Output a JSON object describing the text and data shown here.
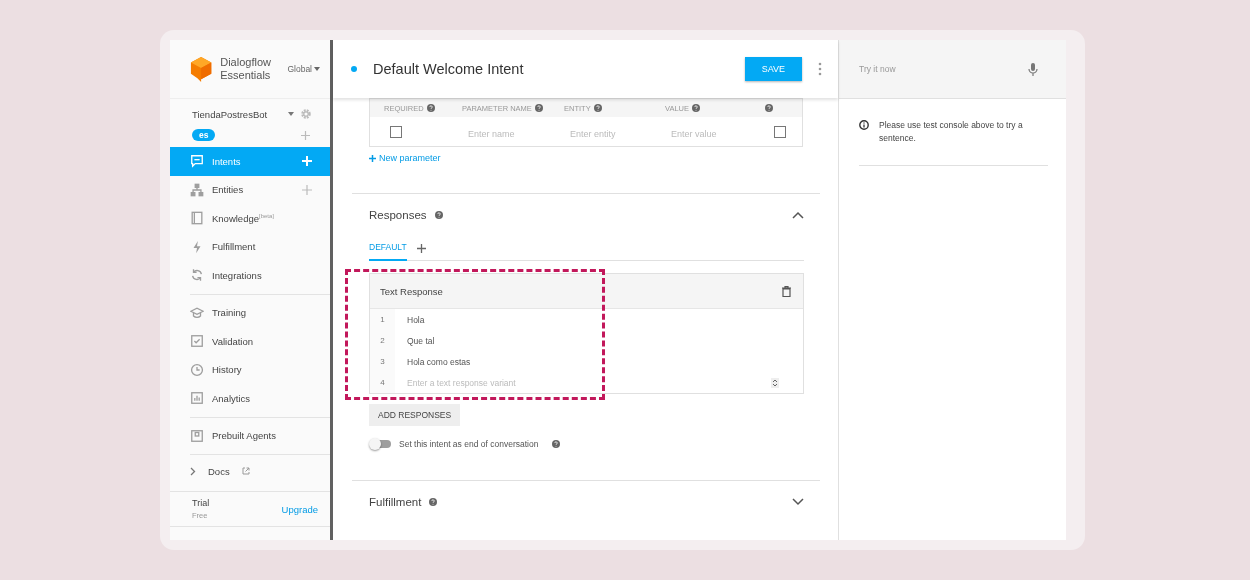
{
  "sidebar": {
    "logo": {
      "line1": "Dialogflow",
      "line2": "Essentials"
    },
    "region": "Global",
    "agent": "TiendaPostresBot",
    "language": "es",
    "groups": [
      [
        {
          "kind": "intents",
          "label": "Intents",
          "selected": true,
          "add": true
        },
        {
          "kind": "entities",
          "label": "Entities",
          "selected": false,
          "add": true
        },
        {
          "kind": "knowledge",
          "label": "Knowledge",
          "badge": "[beta]",
          "selected": false,
          "add": false
        },
        {
          "kind": "fulfillment",
          "label": "Fulfillment",
          "selected": false,
          "add": false
        },
        {
          "kind": "integrations",
          "label": "Integrations",
          "selected": false,
          "add": false
        }
      ],
      [
        {
          "kind": "training",
          "label": "Training",
          "selected": false,
          "add": false
        },
        {
          "kind": "validation",
          "label": "Validation",
          "selected": false,
          "add": false
        },
        {
          "kind": "history",
          "label": "History",
          "selected": false,
          "add": false
        },
        {
          "kind": "analytics",
          "label": "Analytics",
          "selected": false,
          "add": false
        }
      ],
      [
        {
          "kind": "agents",
          "label": "Prebuilt Agents",
          "selected": false,
          "add": false
        }
      ]
    ],
    "docs": "Docs",
    "plan": {
      "name": "Trial",
      "tier": "Free",
      "upgrade": "Upgrade"
    }
  },
  "header": {
    "title": "Default Welcome Intent",
    "save": "SAVE"
  },
  "parameters": {
    "columns": [
      "REQUIRED",
      "PARAMETER NAME",
      "ENTITY",
      "VALUE"
    ],
    "row": {
      "required": false,
      "placeholders": [
        "Enter name",
        "Enter entity",
        "Enter value"
      ],
      "is_list": false
    },
    "add_link": "New parameter"
  },
  "responses": {
    "title": "Responses",
    "expanded": true,
    "tabs": [
      {
        "label": "DEFAULT",
        "selected": true
      }
    ],
    "card": {
      "title": "Text Response",
      "lines": [
        {
          "number": "1",
          "text": "Hola"
        },
        {
          "number": "2",
          "text": "Que tal"
        },
        {
          "number": "3",
          "text": "Hola como estas"
        }
      ],
      "new_line": {
        "number": "4",
        "placeholder": "Enter a text response variant"
      }
    },
    "add_button": "ADD RESPONSES",
    "end_toggle": {
      "label": "Set this intent as end of conversation",
      "on": false
    }
  },
  "fulfillment": {
    "title": "Fulfillment",
    "expanded": false
  },
  "console": {
    "placeholder": "Try it now",
    "message": "Please use test console above to try a sentence."
  }
}
